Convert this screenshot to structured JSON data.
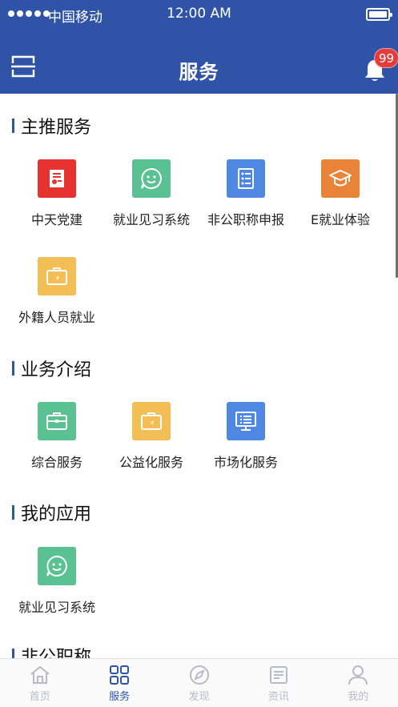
{
  "status_bar": {
    "carrier": "中国移动",
    "time": "12:00 AM"
  },
  "nav": {
    "title": "服务",
    "badge_count": "99"
  },
  "colors": {
    "primary": "#2f54a7",
    "red": "#e6332f",
    "green": "#5ac192",
    "blue": "#4f88e3",
    "orange": "#e98338",
    "yellow": "#f3be55"
  },
  "sections": [
    {
      "title": "主推服务",
      "items": [
        {
          "label": "中天党建",
          "icon": "party-building-icon",
          "color": "#e6332f"
        },
        {
          "label": "就业见习系统",
          "icon": "smile-chat-icon",
          "color": "#5ac192"
        },
        {
          "label": "非公职称申报",
          "icon": "checklist-icon",
          "color": "#4f88e3"
        },
        {
          "label": "E就业体验",
          "icon": "graduation-cap-icon",
          "color": "#e98338"
        },
        {
          "label": "外籍人员就业",
          "icon": "briefcase-icon",
          "color": "#f3be55"
        }
      ]
    },
    {
      "title": "业务介绍",
      "items": [
        {
          "label": "综合服务",
          "icon": "toolbox-icon",
          "color": "#5ac192"
        },
        {
          "label": "公益化服务",
          "icon": "briefcase-icon",
          "color": "#f3be55"
        },
        {
          "label": "市场化服务",
          "icon": "monitor-icon",
          "color": "#4f88e3"
        }
      ]
    },
    {
      "title": "我的应用",
      "items": [
        {
          "label": "就业见习系统",
          "icon": "smile-chat-icon",
          "color": "#5ac192"
        }
      ]
    },
    {
      "title": "非公职称",
      "items": []
    }
  ],
  "tabs": [
    {
      "label": "首页",
      "icon": "home-icon",
      "active": false
    },
    {
      "label": "服务",
      "icon": "grid-icon",
      "active": true
    },
    {
      "label": "发现",
      "icon": "compass-icon",
      "active": false
    },
    {
      "label": "资讯",
      "icon": "news-icon",
      "active": false
    },
    {
      "label": "我的",
      "icon": "user-icon",
      "active": false
    }
  ]
}
